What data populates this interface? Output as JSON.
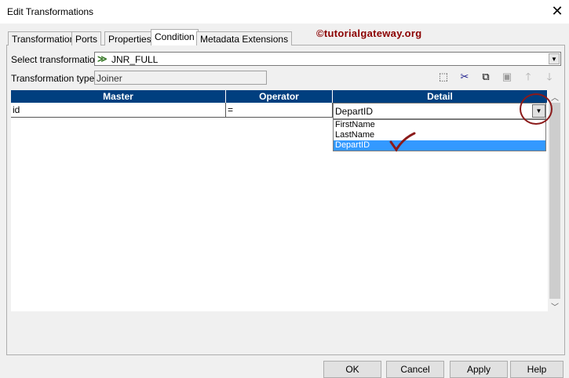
{
  "window": {
    "title": "Edit Transformations",
    "close": "✕"
  },
  "watermark": "©tutorialgateway.org",
  "tabs": [
    {
      "label": "Transformation"
    },
    {
      "label": "Ports"
    },
    {
      "label": "Properties"
    },
    {
      "label": "Condition"
    },
    {
      "label": "Metadata Extensions"
    }
  ],
  "active_tab": "Condition",
  "select_transformation": {
    "label": "Select transformation:",
    "value": "JNR_FULL"
  },
  "transformation_type": {
    "label": "Transformation type:",
    "value": "Joiner"
  },
  "toolbar": [
    "new-icon",
    "cut-icon",
    "copy-icon",
    "paste-icon",
    "move-up-icon",
    "move-down-icon"
  ],
  "grid": {
    "columns": [
      "Master",
      "Operator",
      "Detail"
    ],
    "rows": [
      {
        "master": "id",
        "operator": "=",
        "detail": "DepartID"
      }
    ]
  },
  "detail_dropdown": {
    "options": [
      "FirstName",
      "LastName",
      "DepartID"
    ],
    "selected": "DepartID"
  },
  "buttons": {
    "ok": "OK",
    "cancel": "Cancel",
    "apply": "Apply",
    "help": "Help"
  },
  "colors": {
    "header": "#003f7f",
    "selection": "#3399ff",
    "annotation": "#8b1a1a"
  }
}
